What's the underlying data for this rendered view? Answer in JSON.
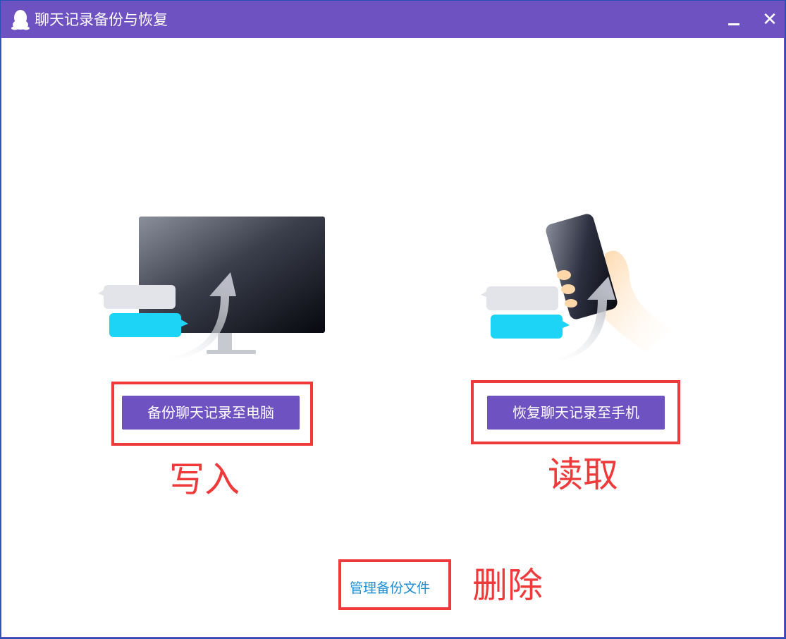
{
  "window": {
    "title": "聊天记录备份与恢复",
    "minimize_label": "minimize",
    "close_glyph": "✕"
  },
  "actions": {
    "backup_label": "备份聊天记录至电脑",
    "restore_label": "恢复聊天记录至手机",
    "manage_label": "管理备份文件"
  },
  "annotations": {
    "write": "写入",
    "read": "读取",
    "delete": "删除"
  },
  "icons": {
    "logo": "qq-penguin-icon",
    "minimize": "minimize-icon",
    "close": "close-icon",
    "backup_illustration": "computer-backup-illustration",
    "restore_illustration": "phone-restore-illustration"
  },
  "colors": {
    "accent": "#6f52c2",
    "annotation_red": "#ee3a3a",
    "link_blue": "#1d8fd6"
  }
}
